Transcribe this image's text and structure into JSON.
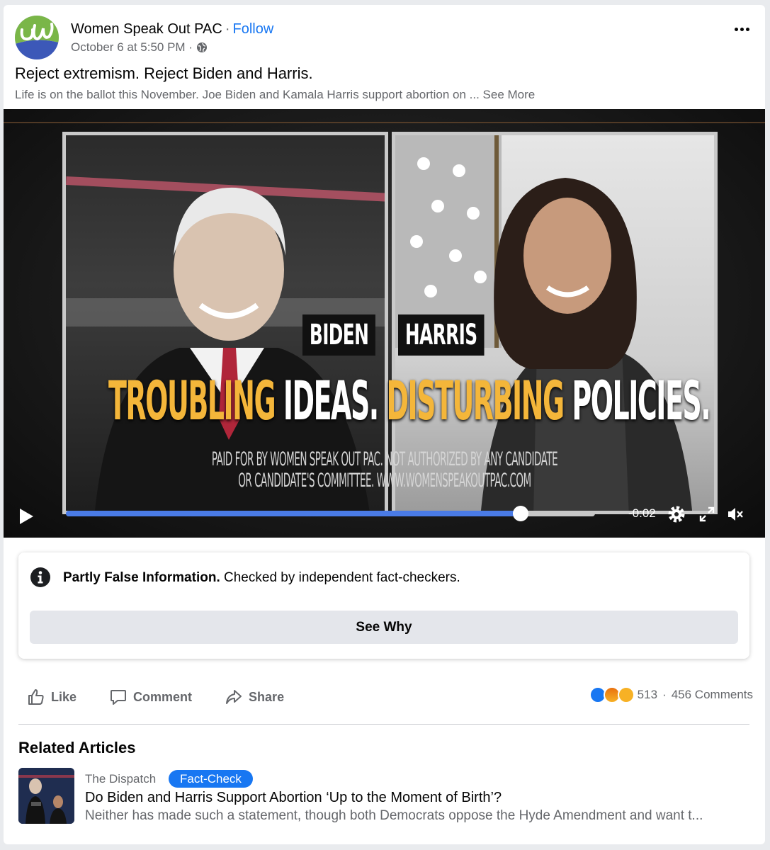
{
  "post": {
    "page_name": "Women Speak Out PAC",
    "separator": "·",
    "follow_label": "Follow",
    "timestamp": "October 6 at 5:50 PM ·",
    "privacy_icon": "globe-icon",
    "more_icon": "more-options-icon",
    "title": "Reject extremism. Reject Biden and Harris.",
    "description": "Life is on the ballot this November. Joe Biden and Kamala Harris support abortion on ...",
    "see_more_label": "See More"
  },
  "video": {
    "name_tag_left": "BIDEN",
    "name_tag_right": "HARRIS",
    "headline_parts": [
      "TROUBLING",
      "IDEAS.",
      "DISTURBING",
      "POLICIES."
    ],
    "disclaimer_line1": "PAID FOR BY WOMEN SPEAK OUT PAC. NOT AUTHORIZED BY ANY CANDIDATE",
    "disclaimer_line2": "OR CANDIDATE'S COMMITTEE. WWW.WOMENSPEAKOUTPAC.COM",
    "time_remaining": "-0:02",
    "progress": 0.86,
    "icons": [
      "play-icon",
      "settings-icon",
      "fullscreen-icon",
      "muted-icon"
    ]
  },
  "fact_check": {
    "rating": "Partly False Information.",
    "checked_by": "Checked by independent fact-checkers.",
    "button_label": "See Why",
    "icon": "info-icon"
  },
  "actions": {
    "like_label": "Like",
    "comment_label": "Comment",
    "share_label": "Share"
  },
  "stats": {
    "reaction_count": "513",
    "separator": "·",
    "comment_count": "456 Comments",
    "reaction_colors": [
      "#1877f2",
      "#e9710f",
      "#f7b125"
    ]
  },
  "related": {
    "heading": "Related Articles",
    "articles": [
      {
        "source": "The Dispatch",
        "badge": "Fact-Check",
        "title": "Do Biden and Harris Support Abortion ‘Up to the Moment of Birth’?",
        "snippet": "Neither has made such a statement, though both Democrats oppose the Hyde Amendment and want t..."
      }
    ]
  },
  "colors": {
    "accent": "#1877f2",
    "headline_yellow": "#f4b63a",
    "progress_fill": "#4a7be6"
  }
}
